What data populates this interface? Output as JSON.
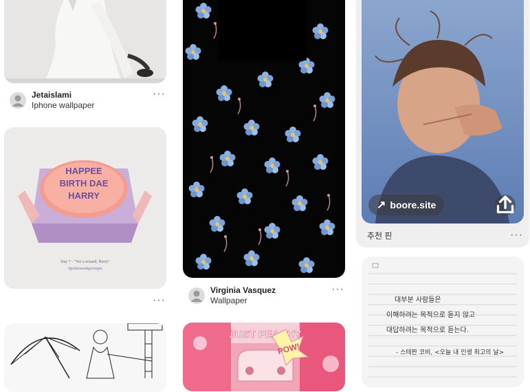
{
  "pins": [
    {
      "id": "dress",
      "author": "Jetaislami",
      "board": "Iphone wallpaper"
    },
    {
      "id": "cake",
      "card_lines": [
        "Day 7 - \"Yer a wizard, Harry\"",
        "#potterweekprompts"
      ]
    },
    {
      "id": "floral",
      "author": "Virginia Vasquez",
      "board": "Wallpaper"
    },
    {
      "id": "sketch"
    },
    {
      "id": "peach",
      "collage_texts": [
        "JUST PEACHY",
        "POW!"
      ]
    },
    {
      "id": "girl",
      "link_label": "boore.site",
      "recommend": "추천 핀"
    },
    {
      "id": "note",
      "lines": [
        "대부분 사람들은",
        "이해하려는 목적으로 듣지 않고",
        "대답하려는 목적으로 듣는다.",
        "- 스테판 코비, <오늘 내 인생 최고의 날>"
      ]
    }
  ],
  "cake_text": [
    "HAPPEE",
    "BIRTH DAE",
    "HARRY"
  ],
  "more_symbol": "···",
  "icons": {
    "avatar": "user-silhouette-icon",
    "share": "share-icon",
    "link": "arrow-up-right-icon",
    "more": "ellipsis-icon"
  }
}
